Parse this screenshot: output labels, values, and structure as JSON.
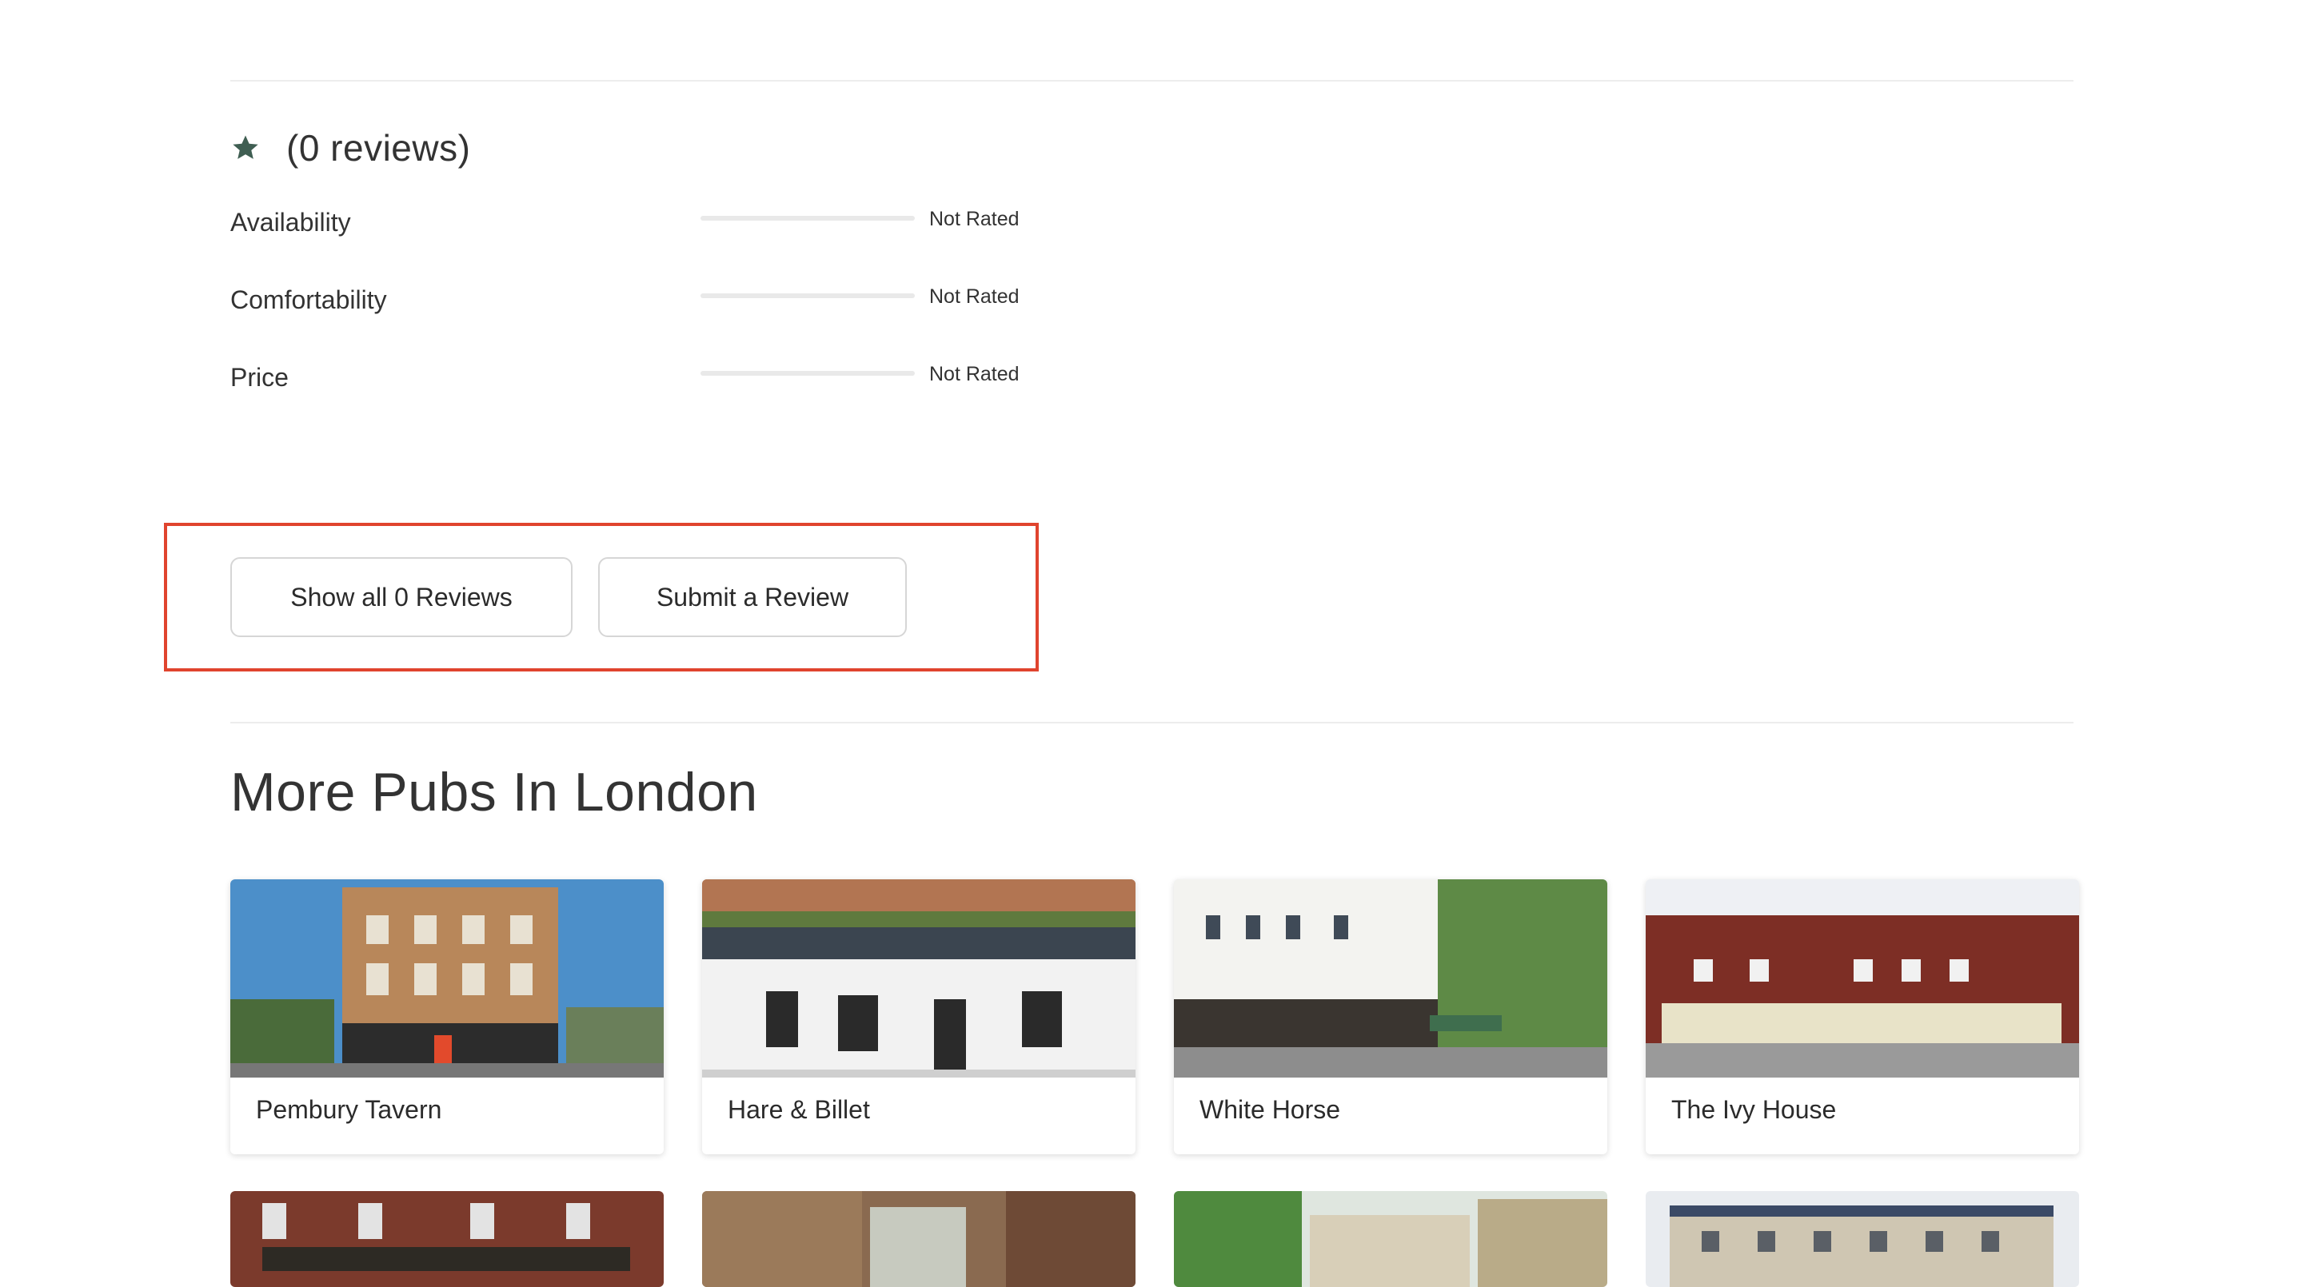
{
  "rating": {
    "review_count_label": "(0 reviews)",
    "star_color": "#3f5e52",
    "metrics": [
      {
        "label": "Availability",
        "value_label": "Not Rated",
        "level": 0
      },
      {
        "label": "Comfortability",
        "value_label": "Not Rated",
        "level": 0
      },
      {
        "label": "Price",
        "value_label": "Not Rated",
        "level": 0
      }
    ]
  },
  "actions": {
    "show_all_label": "Show all 0 Reviews",
    "submit_label": "Submit a Review",
    "highlight_color": "#e0442e"
  },
  "more": {
    "title": "More Pubs In London",
    "cards": [
      {
        "name": "Pembury Tavern"
      },
      {
        "name": "Hare & Billet"
      },
      {
        "name": "White Horse"
      },
      {
        "name": "The Ivy House"
      }
    ]
  }
}
